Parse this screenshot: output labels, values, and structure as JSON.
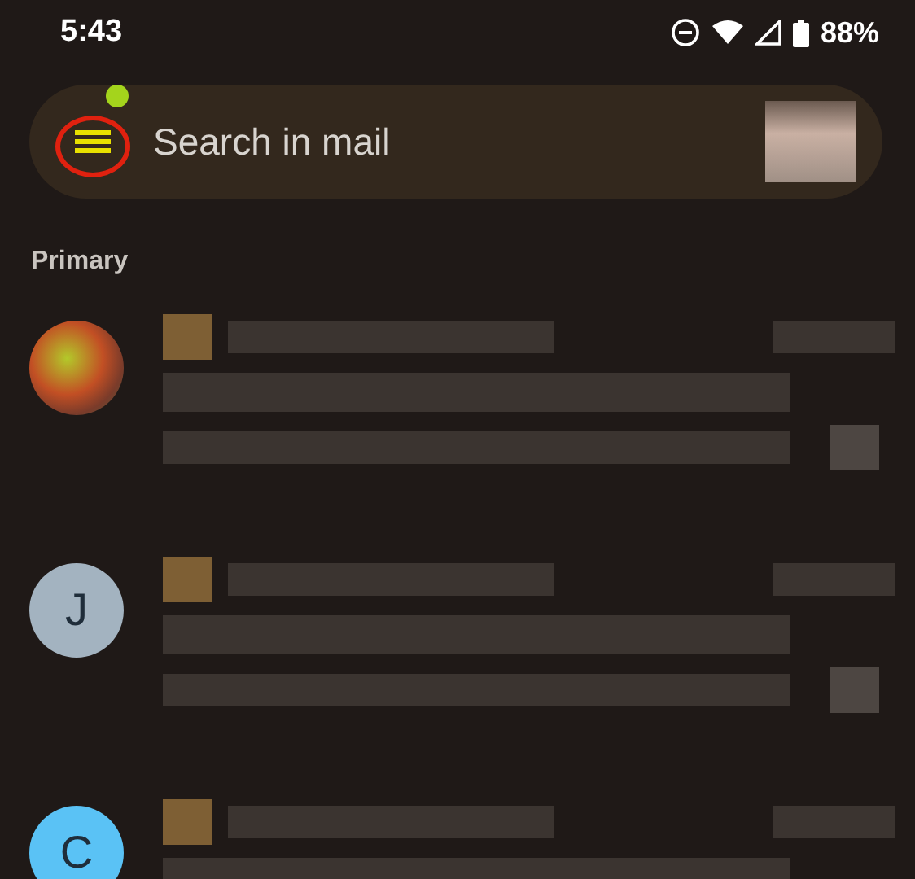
{
  "status_bar": {
    "time": "5:43",
    "battery": "88%"
  },
  "search_bar": {
    "placeholder": "Search in mail",
    "menu_highlighted": true
  },
  "section_label": "Primary",
  "messages": [
    {
      "avatar": {
        "kind": "image"
      }
    },
    {
      "avatar": {
        "kind": "letter",
        "letter": "J",
        "color": "#a3b3c0"
      }
    },
    {
      "avatar": {
        "kind": "letter",
        "letter": "C",
        "color": "#5ac2f5"
      }
    }
  ]
}
